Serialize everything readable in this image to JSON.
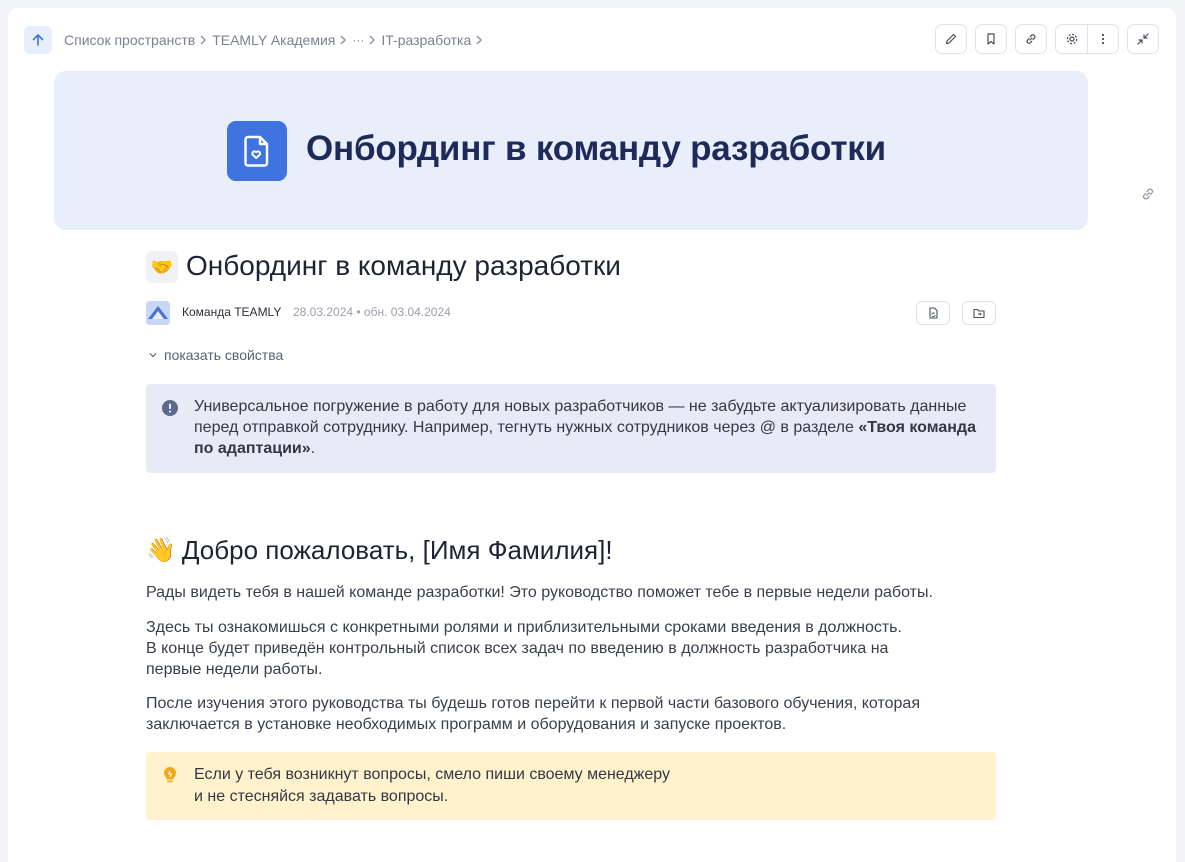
{
  "breadcrumb": {
    "items": [
      "Список пространств",
      "TEAMLY Академия",
      "···",
      "IT-разработка"
    ]
  },
  "icons": {
    "up": "arrow-up-icon",
    "edit": "pencil-icon",
    "bookmark": "bookmark-icon",
    "link": "link-icon",
    "settings": "gear-icon",
    "more": "more-vertical-icon",
    "collapse": "collapse-icon"
  },
  "banner": {
    "title": "Онбординг в команду разработки",
    "icon_color": "#3f73e0"
  },
  "page": {
    "emoji": "🤝",
    "title": "Онбординг в команду разработки",
    "author": "Команда TEAMLY",
    "dates": "28.03.2024 • обн. 03.04.2024",
    "show_properties": "показать свойства"
  },
  "info_callout": {
    "text": "Универсальное погружение в работу для новых разработчиков — не забудьте актуализировать данные перед отправкой сотруднику. Например, тегнуть нужных сотрудников через @ в разделе",
    "bold": "«Твоя команда по адаптации»",
    "tail": "."
  },
  "welcome": {
    "emoji": "👋",
    "heading": "Добро пожаловать, [Имя Фамилия]!",
    "p1": "Рады видеть тебя в нашей команде разработки! Это руководство поможет тебе в первые недели работы.",
    "p2_line1": "Здесь ты ознакомишься с конкретными ролями и приблизительными сроками введения в должность.",
    "p2_line2": "В конце будет приведён контрольный список всех задач по введению в должность разработчика на первые недели работы.",
    "p3": "После изучения этого руководства ты будешь готов перейти к первой части базового обучения, которая заключается в установке необходимых программ и оборудования и запуске проектов."
  },
  "tip_callout": {
    "line1": "Если у тебя возникнут вопросы, смело пиши своему менеджеру",
    "line2": "и не стесняйся задавать вопросы."
  },
  "colors": {
    "accent": "#3f73e0",
    "banner_bg": "#e9eefb",
    "info_bg": "#e8ebf5",
    "tip_bg": "#fff2cc"
  }
}
